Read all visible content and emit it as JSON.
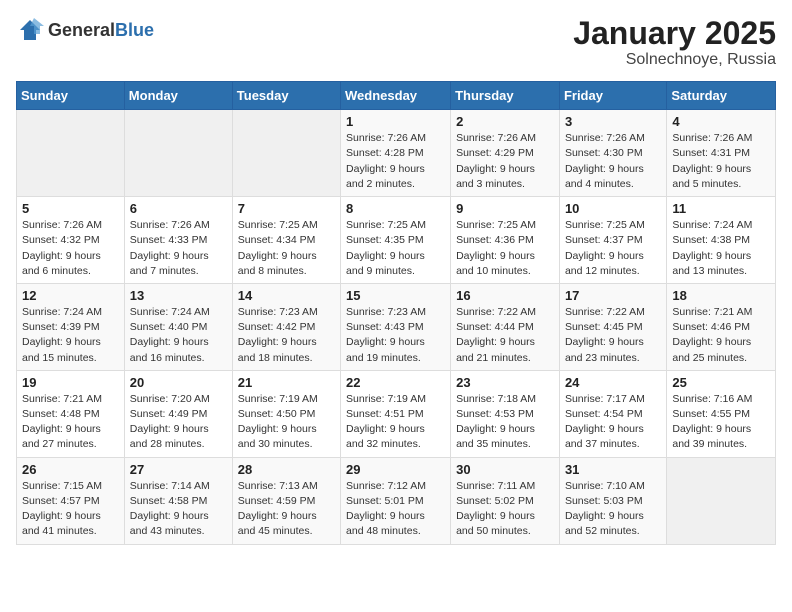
{
  "logo": {
    "general": "General",
    "blue": "Blue"
  },
  "title": "January 2025",
  "subtitle": "Solnechnoye, Russia",
  "weekdays": [
    "Sunday",
    "Monday",
    "Tuesday",
    "Wednesday",
    "Thursday",
    "Friday",
    "Saturday"
  ],
  "weeks": [
    [
      {
        "day": "",
        "info": ""
      },
      {
        "day": "",
        "info": ""
      },
      {
        "day": "",
        "info": ""
      },
      {
        "day": "1",
        "info": "Sunrise: 7:26 AM\nSunset: 4:28 PM\nDaylight: 9 hours and 2 minutes."
      },
      {
        "day": "2",
        "info": "Sunrise: 7:26 AM\nSunset: 4:29 PM\nDaylight: 9 hours and 3 minutes."
      },
      {
        "day": "3",
        "info": "Sunrise: 7:26 AM\nSunset: 4:30 PM\nDaylight: 9 hours and 4 minutes."
      },
      {
        "day": "4",
        "info": "Sunrise: 7:26 AM\nSunset: 4:31 PM\nDaylight: 9 hours and 5 minutes."
      }
    ],
    [
      {
        "day": "5",
        "info": "Sunrise: 7:26 AM\nSunset: 4:32 PM\nDaylight: 9 hours and 6 minutes."
      },
      {
        "day": "6",
        "info": "Sunrise: 7:26 AM\nSunset: 4:33 PM\nDaylight: 9 hours and 7 minutes."
      },
      {
        "day": "7",
        "info": "Sunrise: 7:25 AM\nSunset: 4:34 PM\nDaylight: 9 hours and 8 minutes."
      },
      {
        "day": "8",
        "info": "Sunrise: 7:25 AM\nSunset: 4:35 PM\nDaylight: 9 hours and 9 minutes."
      },
      {
        "day": "9",
        "info": "Sunrise: 7:25 AM\nSunset: 4:36 PM\nDaylight: 9 hours and 10 minutes."
      },
      {
        "day": "10",
        "info": "Sunrise: 7:25 AM\nSunset: 4:37 PM\nDaylight: 9 hours and 12 minutes."
      },
      {
        "day": "11",
        "info": "Sunrise: 7:24 AM\nSunset: 4:38 PM\nDaylight: 9 hours and 13 minutes."
      }
    ],
    [
      {
        "day": "12",
        "info": "Sunrise: 7:24 AM\nSunset: 4:39 PM\nDaylight: 9 hours and 15 minutes."
      },
      {
        "day": "13",
        "info": "Sunrise: 7:24 AM\nSunset: 4:40 PM\nDaylight: 9 hours and 16 minutes."
      },
      {
        "day": "14",
        "info": "Sunrise: 7:23 AM\nSunset: 4:42 PM\nDaylight: 9 hours and 18 minutes."
      },
      {
        "day": "15",
        "info": "Sunrise: 7:23 AM\nSunset: 4:43 PM\nDaylight: 9 hours and 19 minutes."
      },
      {
        "day": "16",
        "info": "Sunrise: 7:22 AM\nSunset: 4:44 PM\nDaylight: 9 hours and 21 minutes."
      },
      {
        "day": "17",
        "info": "Sunrise: 7:22 AM\nSunset: 4:45 PM\nDaylight: 9 hours and 23 minutes."
      },
      {
        "day": "18",
        "info": "Sunrise: 7:21 AM\nSunset: 4:46 PM\nDaylight: 9 hours and 25 minutes."
      }
    ],
    [
      {
        "day": "19",
        "info": "Sunrise: 7:21 AM\nSunset: 4:48 PM\nDaylight: 9 hours and 27 minutes."
      },
      {
        "day": "20",
        "info": "Sunrise: 7:20 AM\nSunset: 4:49 PM\nDaylight: 9 hours and 28 minutes."
      },
      {
        "day": "21",
        "info": "Sunrise: 7:19 AM\nSunset: 4:50 PM\nDaylight: 9 hours and 30 minutes."
      },
      {
        "day": "22",
        "info": "Sunrise: 7:19 AM\nSunset: 4:51 PM\nDaylight: 9 hours and 32 minutes."
      },
      {
        "day": "23",
        "info": "Sunrise: 7:18 AM\nSunset: 4:53 PM\nDaylight: 9 hours and 35 minutes."
      },
      {
        "day": "24",
        "info": "Sunrise: 7:17 AM\nSunset: 4:54 PM\nDaylight: 9 hours and 37 minutes."
      },
      {
        "day": "25",
        "info": "Sunrise: 7:16 AM\nSunset: 4:55 PM\nDaylight: 9 hours and 39 minutes."
      }
    ],
    [
      {
        "day": "26",
        "info": "Sunrise: 7:15 AM\nSunset: 4:57 PM\nDaylight: 9 hours and 41 minutes."
      },
      {
        "day": "27",
        "info": "Sunrise: 7:14 AM\nSunset: 4:58 PM\nDaylight: 9 hours and 43 minutes."
      },
      {
        "day": "28",
        "info": "Sunrise: 7:13 AM\nSunset: 4:59 PM\nDaylight: 9 hours and 45 minutes."
      },
      {
        "day": "29",
        "info": "Sunrise: 7:12 AM\nSunset: 5:01 PM\nDaylight: 9 hours and 48 minutes."
      },
      {
        "day": "30",
        "info": "Sunrise: 7:11 AM\nSunset: 5:02 PM\nDaylight: 9 hours and 50 minutes."
      },
      {
        "day": "31",
        "info": "Sunrise: 7:10 AM\nSunset: 5:03 PM\nDaylight: 9 hours and 52 minutes."
      },
      {
        "day": "",
        "info": ""
      }
    ]
  ]
}
